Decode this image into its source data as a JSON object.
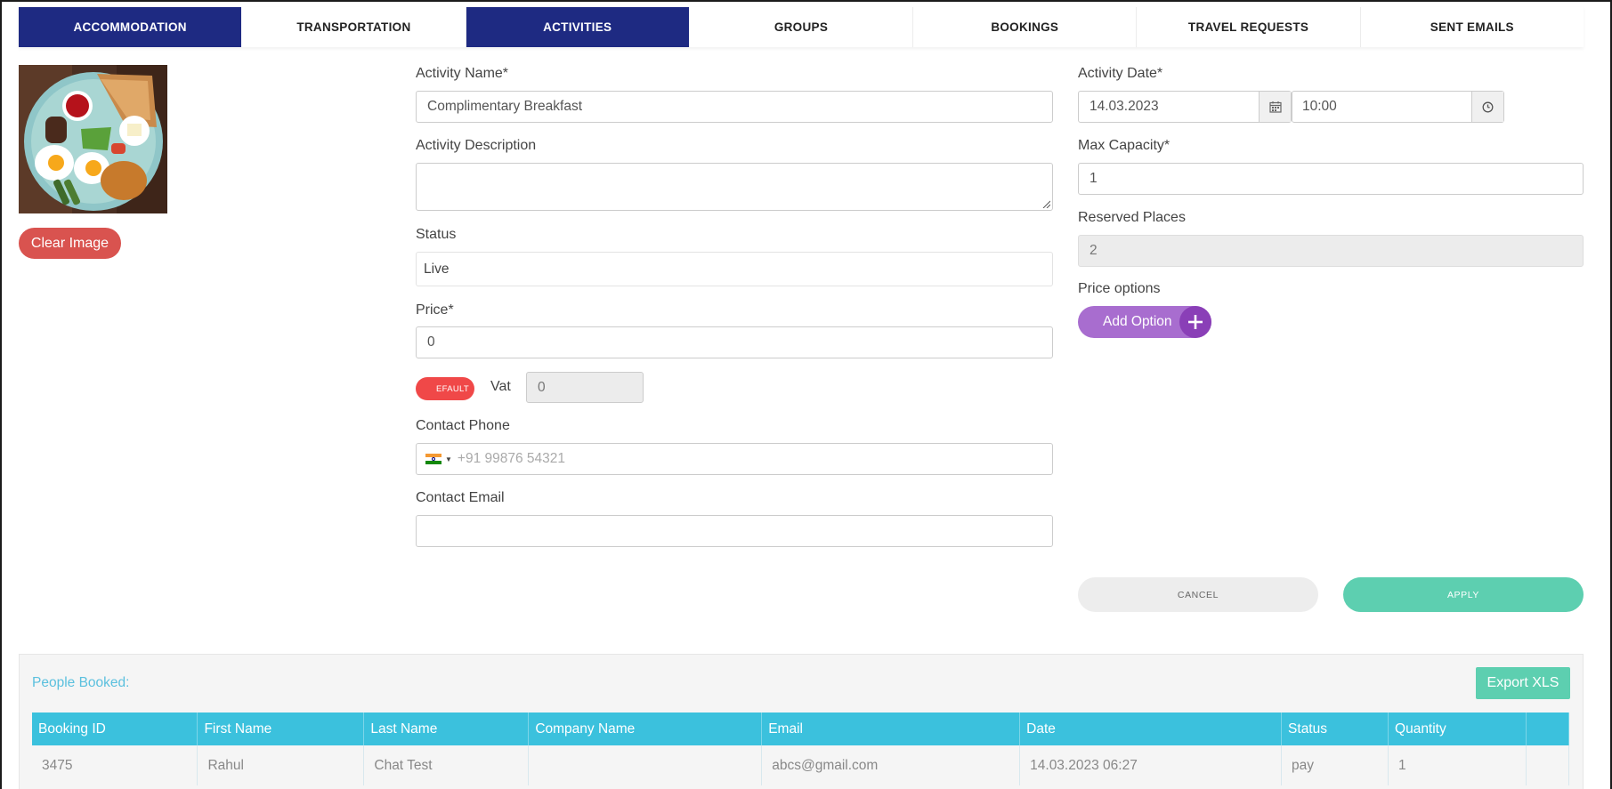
{
  "tabs": [
    {
      "label": "ACCOMMODATION",
      "active": true
    },
    {
      "label": "TRANSPORTATION",
      "active": false
    },
    {
      "label": "ACTIVITIES",
      "active": true
    },
    {
      "label": "GROUPS",
      "active": false
    },
    {
      "label": "BOOKINGS",
      "active": false
    },
    {
      "label": "TRAVEL REQUESTS",
      "active": false
    },
    {
      "label": "SENT EMAILS",
      "active": false
    }
  ],
  "image": {
    "clear_label": "Clear Image"
  },
  "form": {
    "activity_name_label": "Activity Name*",
    "activity_name_value": "Complimentary Breakfast",
    "activity_description_label": "Activity Description",
    "activity_description_value": "",
    "status_label": "Status",
    "status_value": "Live",
    "price_label": "Price*",
    "price_value": "0",
    "toggle_label": "DEFAULT",
    "vat_label": "Vat",
    "vat_value": "0",
    "contact_phone_label": "Contact Phone",
    "contact_phone_placeholder": "+91 99876 54321",
    "contact_email_label": "Contact Email",
    "contact_email_value": "",
    "activity_date_label": "Activity Date*",
    "activity_date_value": "14.03.2023",
    "activity_time_value": "10:00",
    "max_capacity_label": "Max Capacity*",
    "max_capacity_value": "1",
    "reserved_places_label": "Reserved Places",
    "reserved_places_value": "2",
    "price_options_label": "Price options",
    "add_option_label": "Add Option",
    "cancel_label": "CANCEL",
    "apply_label": "APPLY"
  },
  "booked": {
    "title": "People Booked:",
    "export_label": "Export XLS",
    "columns": [
      "Booking ID",
      "First Name",
      "Last Name",
      "Company Name",
      "Email",
      "Date",
      "Status",
      "Quantity",
      ""
    ],
    "rows": [
      [
        "3475",
        "Rahul",
        "Chat Test",
        "",
        "abcs@gmail.com",
        "14.03.2023 06:27",
        "pay",
        "1",
        ""
      ]
    ]
  },
  "colors": {
    "tab_active": "#1e2a82",
    "danger": "#d9534f",
    "toggle": "#f04848",
    "purple": "#a86dcf",
    "teal": "#5dcfb0",
    "table_header": "#3bc1dd",
    "section_title": "#5bc0de"
  }
}
